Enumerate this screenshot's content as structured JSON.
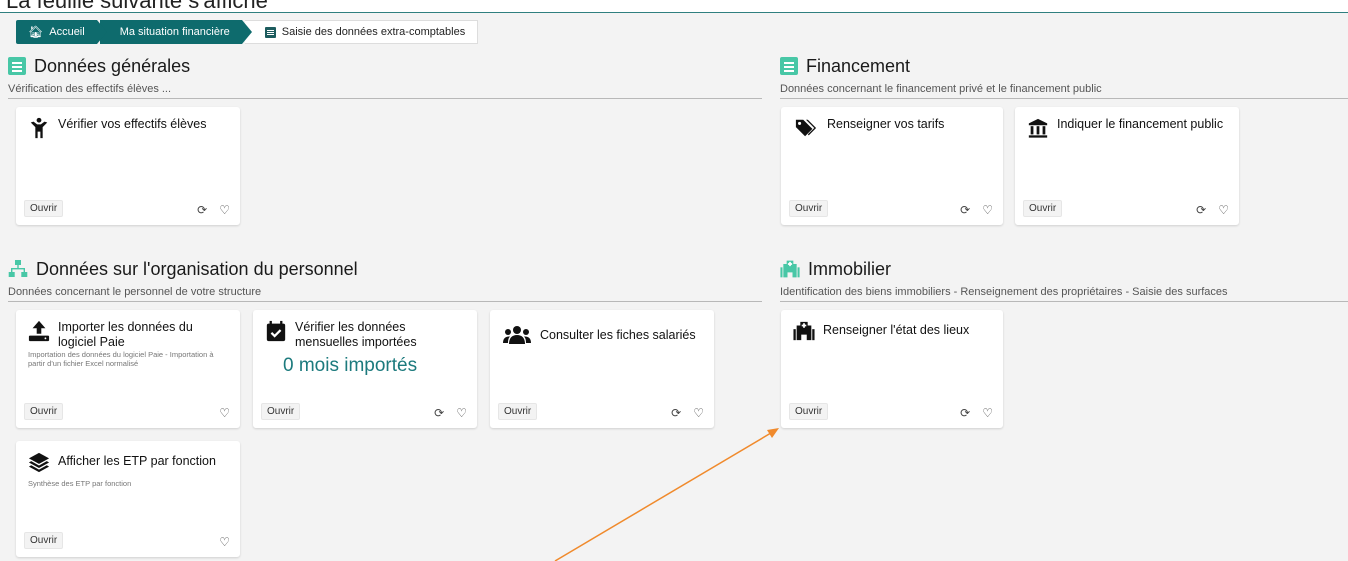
{
  "header_cut_text": "La feuille suivante s'affiche",
  "breadcrumb": {
    "home": "Accueil",
    "situation": "Ma situation financière",
    "current": "Saisie des données extra-comptables"
  },
  "sections": {
    "generales": {
      "title": "Données générales",
      "subtitle": "Vérification des effectifs élèves ...",
      "cards": [
        {
          "title": "Vérifier vos effectifs élèves",
          "open": "Ouvrir"
        }
      ]
    },
    "financement": {
      "title": "Financement",
      "subtitle": "Données concernant le financement privé et le financement public",
      "cards": [
        {
          "title": "Renseigner vos tarifs",
          "open": "Ouvrir"
        },
        {
          "title": "Indiquer le financement public",
          "open": "Ouvrir"
        }
      ]
    },
    "personnel": {
      "title": "Données sur l'organisation du personnel",
      "subtitle": "Données concernant le personnel de votre structure",
      "cards": [
        {
          "title": "Importer les données du logiciel Paie",
          "description": "Importation des données du logiciel Paie - Importation à partir d'un fichier Excel normalisé",
          "open": "Ouvrir"
        },
        {
          "title": "Vérifier les données mensuelles importées",
          "count": "0 mois importés",
          "open": "Ouvrir"
        },
        {
          "title": "Consulter les fiches salariés",
          "open": "Ouvrir"
        },
        {
          "title": "Afficher les ETP par fonction",
          "description": "Synthèse des ETP par fonction",
          "open": "Ouvrir"
        }
      ]
    },
    "immobilier": {
      "title": "Immobilier",
      "subtitle": "Identification des biens immobiliers - Renseignement des propriétaires - Saisie des surfaces",
      "cards": [
        {
          "title": "Renseigner l'état des lieux",
          "open": "Ouvrir"
        }
      ]
    }
  },
  "icons": {
    "refresh": "refresh-icon",
    "favorite": "heart-icon",
    "home": "home-icon"
  },
  "colors": {
    "accent": "#0e6b6d",
    "icon_green": "#48c7a6",
    "count_teal": "#1c7a7d",
    "annotation_arrow": "#f08a2c"
  }
}
